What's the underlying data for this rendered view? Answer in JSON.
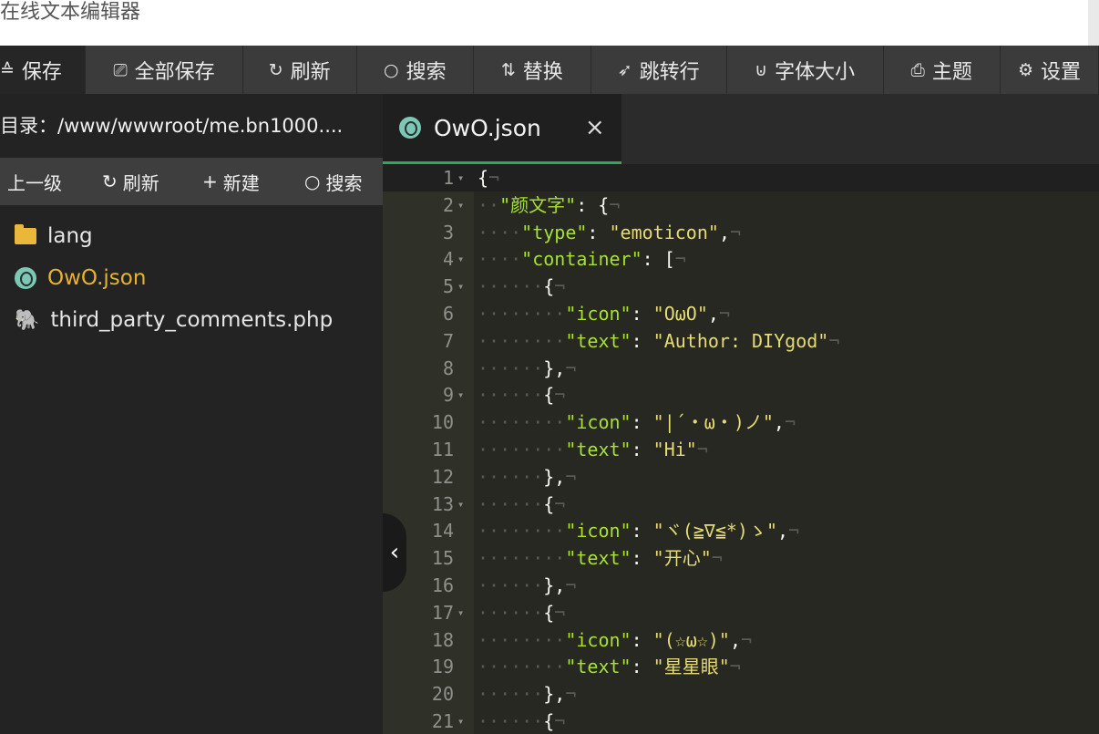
{
  "window": {
    "title": "在线文本编辑器"
  },
  "toolbar": [
    {
      "icon": "≙",
      "label": "保存",
      "name": "save-button",
      "icon_name": "save-icon"
    },
    {
      "icon": "⎚",
      "label": "全部保存",
      "name": "save-all-button",
      "icon_name": "save-all-icon"
    },
    {
      "icon": "↻",
      "label": "刷新",
      "name": "refresh-button",
      "icon_name": "refresh-icon"
    },
    {
      "icon": "○",
      "label": "搜索",
      "name": "search-button",
      "icon_name": "search-icon"
    },
    {
      "icon": "⇅",
      "label": "替换",
      "name": "replace-button",
      "icon_name": "replace-icon"
    },
    {
      "icon": "➶",
      "label": "跳转行",
      "name": "goto-line-button",
      "icon_name": "goto-icon"
    },
    {
      "icon": "⊍",
      "label": "字体大小",
      "name": "font-size-button",
      "icon_name": "font-size-icon"
    },
    {
      "icon": "⎙",
      "label": "主题",
      "name": "theme-button",
      "icon_name": "theme-icon"
    },
    {
      "icon": "⚙",
      "label": "设置",
      "name": "settings-button",
      "icon_name": "gear-icon"
    }
  ],
  "sidebar": {
    "path": "目录：/www/wwwroot/me.bn1000....",
    "tools": [
      {
        "icon": "",
        "label": "上一级",
        "name": "up-level-button"
      },
      {
        "icon": "↻",
        "label": "刷新",
        "name": "side-refresh-button"
      },
      {
        "icon": "+",
        "label": "新建",
        "name": "new-file-button"
      },
      {
        "icon": "○",
        "label": "搜索",
        "name": "side-search-button"
      }
    ],
    "files": [
      {
        "name": "lang",
        "type": "folder",
        "active": false
      },
      {
        "name": "OwO.json",
        "type": "json",
        "active": true
      },
      {
        "name": "third_party_comments.php",
        "type": "php",
        "active": false
      }
    ]
  },
  "editor": {
    "tab": {
      "name": "OwO.json",
      "close": "×"
    },
    "lines": [
      {
        "n": "1",
        "fold": true,
        "segs": [
          [
            "p",
            "{"
          ]
        ]
      },
      {
        "n": "2",
        "fold": true,
        "segs": [
          [
            "d",
            "··"
          ],
          [
            "k",
            "\"颜文字\""
          ],
          [
            "p",
            ": {"
          ]
        ]
      },
      {
        "n": "3",
        "fold": false,
        "segs": [
          [
            "d",
            "····"
          ],
          [
            "k",
            "\"type\""
          ],
          [
            "p",
            ": "
          ],
          [
            "s",
            "\"emoticon\""
          ],
          [
            "p",
            ","
          ]
        ]
      },
      {
        "n": "4",
        "fold": true,
        "segs": [
          [
            "d",
            "····"
          ],
          [
            "k",
            "\"container\""
          ],
          [
            "p",
            ": ["
          ]
        ]
      },
      {
        "n": "5",
        "fold": true,
        "segs": [
          [
            "d",
            "······"
          ],
          [
            "p",
            "{"
          ]
        ]
      },
      {
        "n": "6",
        "fold": false,
        "segs": [
          [
            "d",
            "········"
          ],
          [
            "k",
            "\"icon\""
          ],
          [
            "p",
            ": "
          ],
          [
            "s",
            "\"OωO\""
          ],
          [
            "p",
            ","
          ]
        ]
      },
      {
        "n": "7",
        "fold": false,
        "segs": [
          [
            "d",
            "········"
          ],
          [
            "k",
            "\"text\""
          ],
          [
            "p",
            ": "
          ],
          [
            "s",
            "\"Author: DIYgod\""
          ]
        ]
      },
      {
        "n": "8",
        "fold": false,
        "segs": [
          [
            "d",
            "······"
          ],
          [
            "p",
            "},"
          ]
        ]
      },
      {
        "n": "9",
        "fold": true,
        "segs": [
          [
            "d",
            "······"
          ],
          [
            "p",
            "{"
          ]
        ]
      },
      {
        "n": "10",
        "fold": false,
        "segs": [
          [
            "d",
            "········"
          ],
          [
            "k",
            "\"icon\""
          ],
          [
            "p",
            ": "
          ],
          [
            "s",
            "\"|´・ω・)ノ\""
          ],
          [
            "p",
            ","
          ]
        ]
      },
      {
        "n": "11",
        "fold": false,
        "segs": [
          [
            "d",
            "········"
          ],
          [
            "k",
            "\"text\""
          ],
          [
            "p",
            ": "
          ],
          [
            "s",
            "\"Hi\""
          ]
        ]
      },
      {
        "n": "12",
        "fold": false,
        "segs": [
          [
            "d",
            "······"
          ],
          [
            "p",
            "},"
          ]
        ]
      },
      {
        "n": "13",
        "fold": true,
        "segs": [
          [
            "d",
            "······"
          ],
          [
            "p",
            "{"
          ]
        ]
      },
      {
        "n": "14",
        "fold": false,
        "segs": [
          [
            "d",
            "········"
          ],
          [
            "k",
            "\"icon\""
          ],
          [
            "p",
            ": "
          ],
          [
            "s",
            "\"ヾ(≧∇≦*)ゝ\""
          ],
          [
            "p",
            ","
          ]
        ]
      },
      {
        "n": "15",
        "fold": false,
        "segs": [
          [
            "d",
            "········"
          ],
          [
            "k",
            "\"text\""
          ],
          [
            "p",
            ": "
          ],
          [
            "s",
            "\"开心\""
          ]
        ]
      },
      {
        "n": "16",
        "fold": false,
        "segs": [
          [
            "d",
            "······"
          ],
          [
            "p",
            "},"
          ]
        ]
      },
      {
        "n": "17",
        "fold": true,
        "segs": [
          [
            "d",
            "······"
          ],
          [
            "p",
            "{"
          ]
        ]
      },
      {
        "n": "18",
        "fold": false,
        "segs": [
          [
            "d",
            "········"
          ],
          [
            "k",
            "\"icon\""
          ],
          [
            "p",
            ": "
          ],
          [
            "s",
            "\"(☆ω☆)\""
          ],
          [
            "p",
            ","
          ]
        ]
      },
      {
        "n": "19",
        "fold": false,
        "segs": [
          [
            "d",
            "········"
          ],
          [
            "k",
            "\"text\""
          ],
          [
            "p",
            ": "
          ],
          [
            "s",
            "\"星星眼\""
          ]
        ]
      },
      {
        "n": "20",
        "fold": false,
        "segs": [
          [
            "d",
            "······"
          ],
          [
            "p",
            "},"
          ]
        ]
      },
      {
        "n": "21",
        "fold": true,
        "segs": [
          [
            "d",
            "······"
          ],
          [
            "p",
            "{"
          ]
        ]
      }
    ],
    "eol_mark": "¬",
    "fold_mark": "▾",
    "collapse_icon": "‹"
  },
  "colors": {
    "accent": "#2fa85a",
    "active_file": "#e6b32e",
    "key": "#a6e22e",
    "string": "#e6db74"
  }
}
